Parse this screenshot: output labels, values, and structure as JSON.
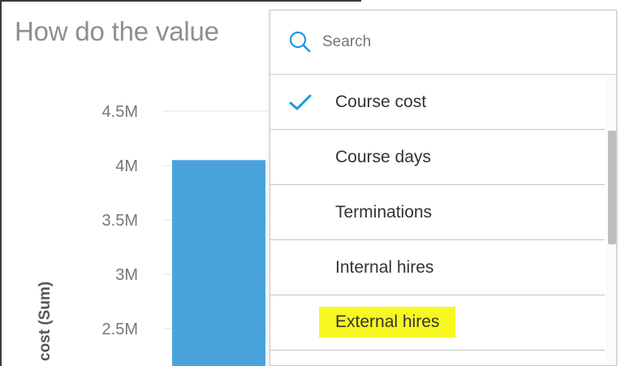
{
  "chart": {
    "title": "How do the value",
    "ylabel": "cost (Sum)"
  },
  "chart_data": {
    "type": "bar",
    "ylabel": "cost (Sum)",
    "yticks": [
      "4.5M",
      "4M",
      "3.5M",
      "3M",
      "2.5M"
    ],
    "ytick_values": [
      4500000,
      4000000,
      3500000,
      3000000,
      2500000
    ],
    "ylim": [
      2200000,
      4700000
    ],
    "series": [
      {
        "values": [
          4050000
        ]
      }
    ],
    "colors": {
      "bar": "#4aa3db",
      "grid": "#e6e6e6"
    }
  },
  "dropdown": {
    "search_placeholder": "Search",
    "options": [
      {
        "label": "Course cost",
        "selected": true,
        "highlighted": false
      },
      {
        "label": "Course days",
        "selected": false,
        "highlighted": false
      },
      {
        "label": "Terminations",
        "selected": false,
        "highlighted": false
      },
      {
        "label": "Internal hires",
        "selected": false,
        "highlighted": false
      },
      {
        "label": "External hires",
        "selected": false,
        "highlighted": true
      }
    ],
    "accent_color": "#1a9be6",
    "highlight_color": "#f7f722"
  }
}
